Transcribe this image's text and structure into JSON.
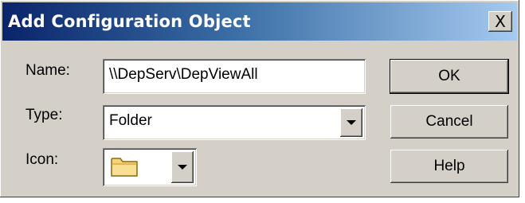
{
  "window": {
    "title": "Add Configuration Object",
    "close_label": "X"
  },
  "form": {
    "name_label": "Name:",
    "name_value": "\\\\DepServ\\DepViewAll",
    "type_label": "Type:",
    "type_value": "Folder",
    "icon_label": "Icon:",
    "icon_value": "folder-icon"
  },
  "buttons": {
    "ok": "OK",
    "cancel": "Cancel",
    "help": "Help"
  },
  "colors": {
    "title_start": "#0a246a",
    "title_end": "#a6caf0",
    "dialog_bg": "#d4d0c8"
  }
}
